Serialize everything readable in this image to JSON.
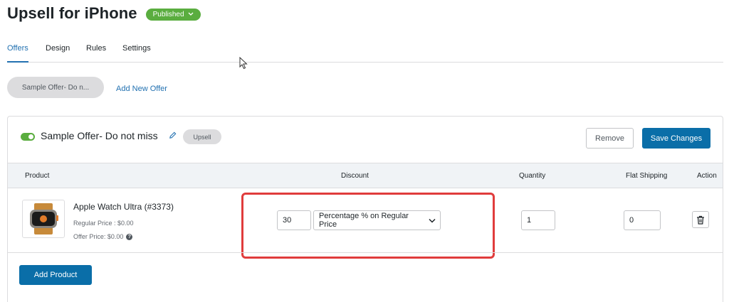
{
  "header": {
    "title": "Upsell for iPhone",
    "status": "Published"
  },
  "tabs": [
    {
      "label": "Offers",
      "active": true
    },
    {
      "label": "Design",
      "active": false
    },
    {
      "label": "Rules",
      "active": false
    },
    {
      "label": "Settings",
      "active": false
    }
  ],
  "offers_bar": {
    "chip_label": "Sample Offer- Do n...",
    "add_new_label": "Add New Offer"
  },
  "offer": {
    "enabled": true,
    "name": "Sample Offer- Do not miss",
    "type_badge": "Upsell",
    "remove_label": "Remove",
    "save_label": "Save Changes"
  },
  "table": {
    "headers": [
      "Product",
      "Discount",
      "Quantity",
      "Flat Shipping",
      "Action"
    ],
    "row": {
      "product_name": "Apple Watch Ultra (#3373)",
      "regular_price": "Regular Price : $0.00",
      "offer_price": "Offer Price: $0.00",
      "discount_value": "30",
      "discount_type": "Percentage % on Regular Price",
      "quantity": "1",
      "flat_shipping": "0"
    }
  },
  "add_product_label": "Add Product",
  "colors": {
    "accent": "#2271b1",
    "primary_button": "#0a6ea8",
    "success": "#5aad3f",
    "highlight": "#e03c3c"
  }
}
